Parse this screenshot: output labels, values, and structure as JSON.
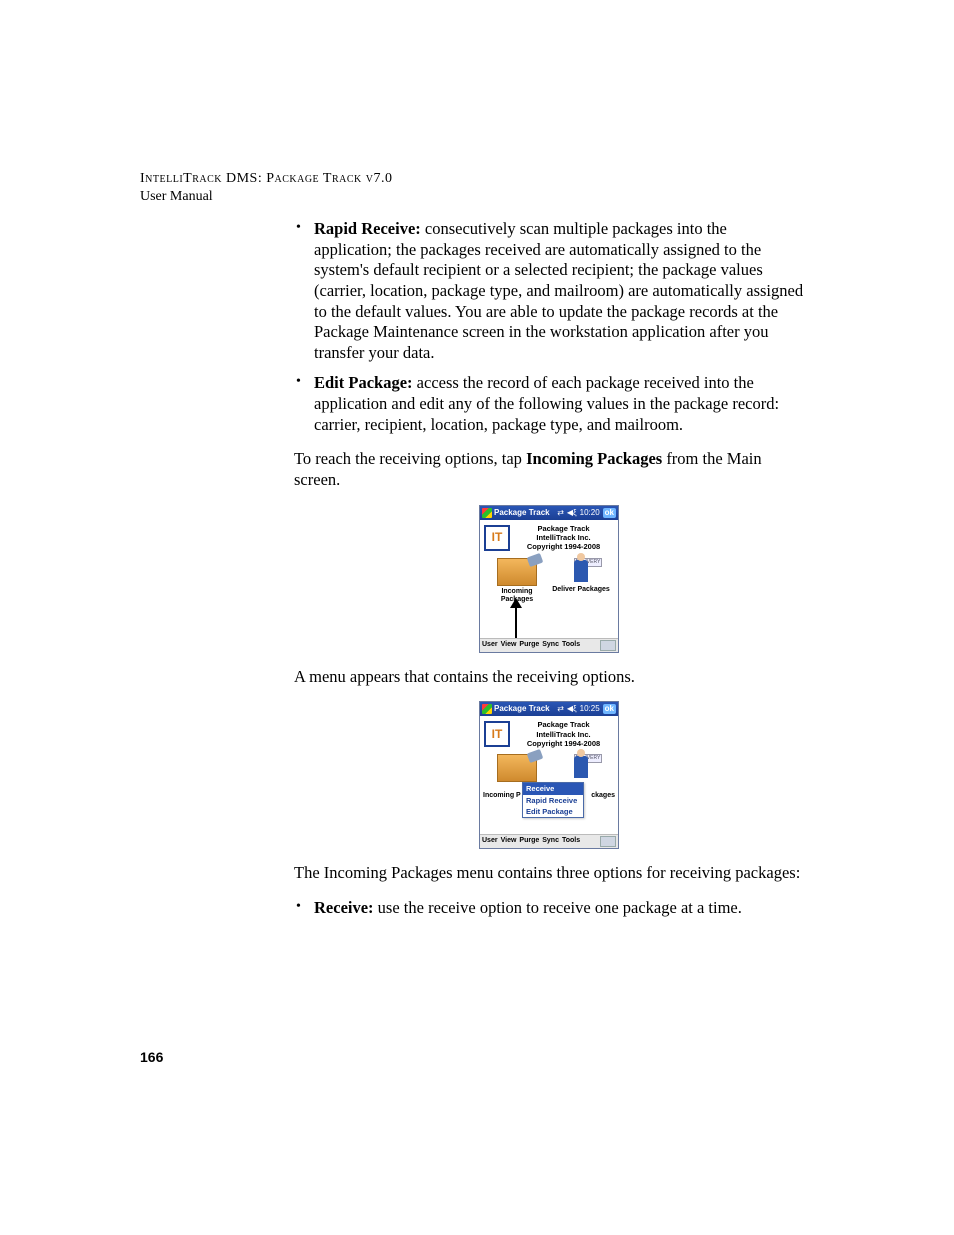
{
  "header": {
    "line1": "IntelliTrack DMS: Package Track v7.0",
    "line2": "User Manual"
  },
  "bullets_top": [
    {
      "lead": "Rapid Receive:",
      "text": " consecutively scan multiple packages into the application; the packages received are automatically assigned to the system's default recipient or a selected recipient; the package values (carrier, location, package type, and mailroom) are automatically assigned to the default values. You are able to update the package records at the Package Maintenance screen in the workstation application after you transfer your data."
    },
    {
      "lead": "Edit Package:",
      "text": " access the record of each package received into the application and edit any of the following values in the package record: carrier, recipient, location, package type, and mailroom."
    }
  ],
  "para_reach_pre": "To reach the receiving options, tap ",
  "para_reach_bold": "Incoming Packages",
  "para_reach_post": " from the Main screen.",
  "pda1": {
    "title": "Package Track",
    "time": "10:20",
    "ok": "ok",
    "top_lines": [
      "Package Track",
      "IntelliTrack Inc.",
      "Copyright 1994-2008"
    ],
    "left_label": "Incoming Packages",
    "right_label": "Deliver Packages",
    "delivery_tag": "DELIVERY",
    "menu": [
      "User",
      "View",
      "Purge",
      "Sync",
      "Tools"
    ]
  },
  "para_menu": "A menu appears that contains the receiving options.",
  "pda2": {
    "title": "Package Track",
    "time": "10:25",
    "ok": "ok",
    "top_lines": [
      "Package Track",
      "IntelliTrack Inc.",
      "Copyright 1994-2008"
    ],
    "incoming_partial": "Incoming P",
    "deliver_partial": "ckages",
    "delivery_tag": "DELIVERY",
    "popup": [
      "Receive",
      "Rapid Receive",
      "Edit Package"
    ],
    "menu": [
      "User",
      "View",
      "Purge",
      "Sync",
      "Tools"
    ]
  },
  "para_three": "The Incoming Packages menu contains three options for receiving packages:",
  "bullets_bottom": [
    {
      "lead": "Receive:",
      "text": " use the receive option to receive one package at a time."
    }
  ],
  "page_number": "166"
}
